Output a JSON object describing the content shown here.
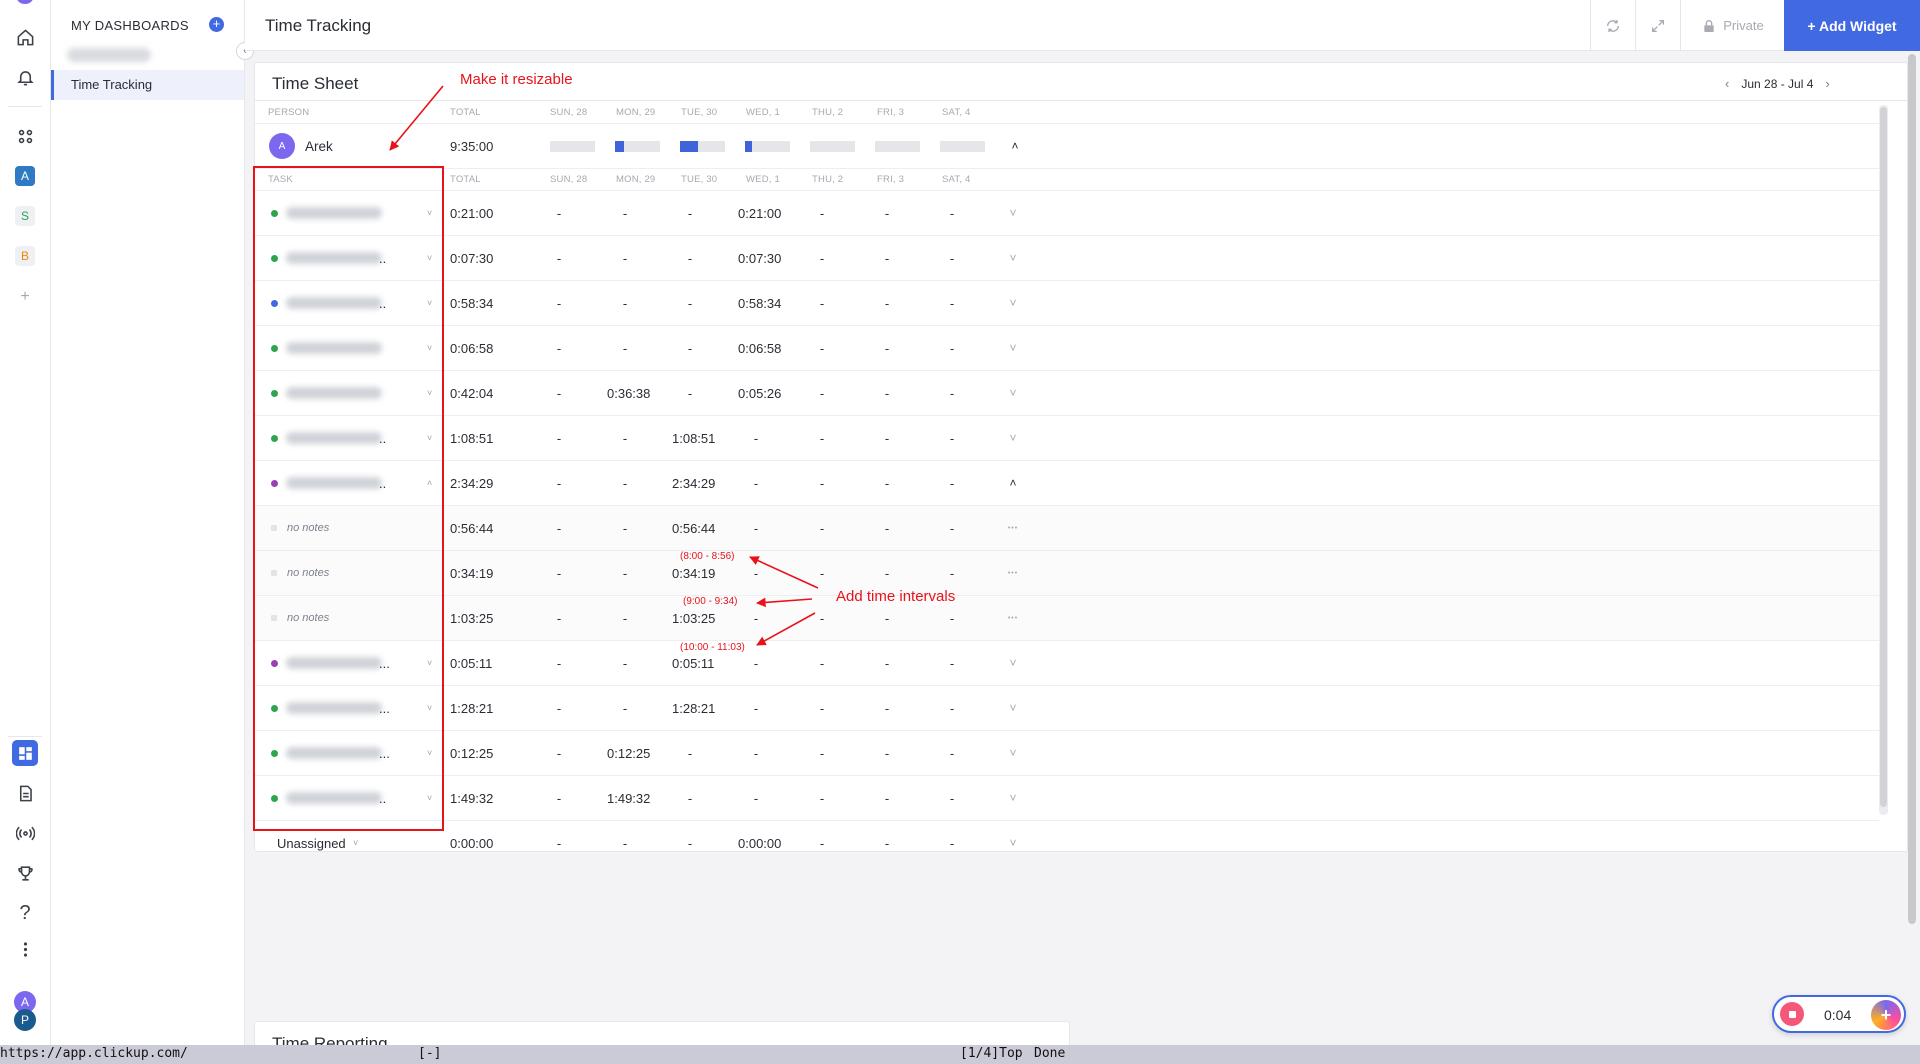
{
  "sidebar": {
    "heading": "MY DASHBOARDS",
    "add_icon": "plus-circle-icon",
    "active_item": "Time Tracking",
    "collapse_icon": "chevron-left-icon"
  },
  "rail": {
    "spaces": [
      {
        "letter": "A",
        "color": "#2e7bc4"
      },
      {
        "letter": "S",
        "color": "#2ea44f"
      },
      {
        "letter": "B",
        "color": "#e8890c"
      }
    ],
    "add_label": "+",
    "avatars": [
      {
        "letter": "A",
        "color": "#7b68ee"
      },
      {
        "letter": "P",
        "color": "#1b5a8f"
      }
    ],
    "help_label": "?"
  },
  "header": {
    "title": "Time Tracking",
    "privacy_label": "Private",
    "add_widget_label": "+ Add Widget"
  },
  "time_sheet": {
    "title": "Time Sheet",
    "date_range": "Jun 28 - Jul 4",
    "person_headers": [
      "PERSON",
      "TOTAL",
      "SUN, 28",
      "MON, 29",
      "TUE, 30",
      "WED, 1",
      "THU, 2",
      "FRI, 3",
      "SAT, 4"
    ],
    "task_headers": [
      "TASK",
      "TOTAL",
      "SUN, 28",
      "MON, 29",
      "TUE, 30",
      "WED, 1",
      "THU, 2",
      "FRI, 3",
      "SAT, 4"
    ],
    "person": {
      "initial": "A",
      "name": "Arek",
      "total": "9:35:00",
      "day_fill": [
        0,
        0.2,
        0.4,
        0.15,
        0,
        0,
        0
      ]
    },
    "tasks": [
      {
        "kind": "task",
        "status_color": "#2ea44f",
        "total": "0:21:00",
        "days": [
          "-",
          "-",
          "-",
          "0:21:00",
          "-",
          "-",
          "-"
        ],
        "ellipsis": "",
        "expanded": false
      },
      {
        "kind": "task",
        "status_color": "#2ea44f",
        "total": "0:07:30",
        "days": [
          "-",
          "-",
          "-",
          "0:07:30",
          "-",
          "-",
          "-"
        ],
        "ellipsis": "..",
        "expanded": false
      },
      {
        "kind": "task",
        "status_color": "#4169e1",
        "total": "0:58:34",
        "days": [
          "-",
          "-",
          "-",
          "0:58:34",
          "-",
          "-",
          "-"
        ],
        "ellipsis": "..",
        "expanded": false
      },
      {
        "kind": "task",
        "status_color": "#2ea44f",
        "total": "0:06:58",
        "days": [
          "-",
          "-",
          "-",
          "0:06:58",
          "-",
          "-",
          "-"
        ],
        "ellipsis": "",
        "expanded": false
      },
      {
        "kind": "task",
        "status_color": "#2ea44f",
        "total": "0:42:04",
        "days": [
          "-",
          "0:36:38",
          "-",
          "0:05:26",
          "-",
          "-",
          "-"
        ],
        "ellipsis": "",
        "expanded": false
      },
      {
        "kind": "task",
        "status_color": "#2ea44f",
        "total": "1:08:51",
        "days": [
          "-",
          "-",
          "1:08:51",
          "-",
          "-",
          "-",
          "-"
        ],
        "ellipsis": "..",
        "expanded": false
      },
      {
        "kind": "task",
        "status_color": "#9b3fb5",
        "total": "2:34:29",
        "days": [
          "-",
          "-",
          "2:34:29",
          "-",
          "-",
          "-",
          "-"
        ],
        "ellipsis": "..",
        "expanded": true
      },
      {
        "kind": "entry",
        "notes": "no notes",
        "total": "0:56:44",
        "days": [
          "-",
          "-",
          "0:56:44",
          "-",
          "-",
          "-",
          "-"
        ]
      },
      {
        "kind": "entry",
        "notes": "no notes",
        "total": "0:34:19",
        "days": [
          "-",
          "-",
          "0:34:19",
          "-",
          "-",
          "-",
          "-"
        ]
      },
      {
        "kind": "entry",
        "notes": "no notes",
        "total": "1:03:25",
        "days": [
          "-",
          "-",
          "1:03:25",
          "-",
          "-",
          "-",
          "-"
        ]
      },
      {
        "kind": "task",
        "status_color": "#9b3fb5",
        "total": "0:05:11",
        "days": [
          "-",
          "-",
          "0:05:11",
          "-",
          "-",
          "-",
          "-"
        ],
        "ellipsis": "...",
        "expanded": false
      },
      {
        "kind": "task",
        "status_color": "#2ea44f",
        "total": "1:28:21",
        "days": [
          "-",
          "-",
          "1:28:21",
          "-",
          "-",
          "-",
          "-"
        ],
        "ellipsis": "...",
        "expanded": false
      },
      {
        "kind": "task",
        "status_color": "#2ea44f",
        "total": "0:12:25",
        "days": [
          "-",
          "0:12:25",
          "-",
          "-",
          "-",
          "-",
          "-"
        ],
        "ellipsis": "...",
        "expanded": false
      },
      {
        "kind": "task",
        "status_color": "#2ea44f",
        "total": "1:49:32",
        "days": [
          "-",
          "1:49:32",
          "-",
          "-",
          "-",
          "-",
          "-"
        ],
        "ellipsis": "..",
        "expanded": false
      }
    ],
    "unassigned": {
      "label": "Unassigned",
      "total": "0:00:00",
      "days": [
        "-",
        "-",
        "-",
        "0:00:00",
        "-",
        "-",
        "-"
      ]
    }
  },
  "annotations": {
    "resize_note": "Make it resizable",
    "intervals_note": "Add time intervals",
    "intervals": [
      "(8:00 - 8:56)",
      "(9:00 - 9:34)",
      "(10:00 - 11:03)"
    ]
  },
  "time_reporting": {
    "title": "Time Reporting"
  },
  "timer": {
    "time": "0:04"
  },
  "statusbar": {
    "url": "https://app.clickup.com/",
    "mode": "[-]",
    "position": "[1/4]Top",
    "state": "Done"
  },
  "colors": {
    "accent": "#4169e1",
    "annotation": "#e8131a"
  }
}
